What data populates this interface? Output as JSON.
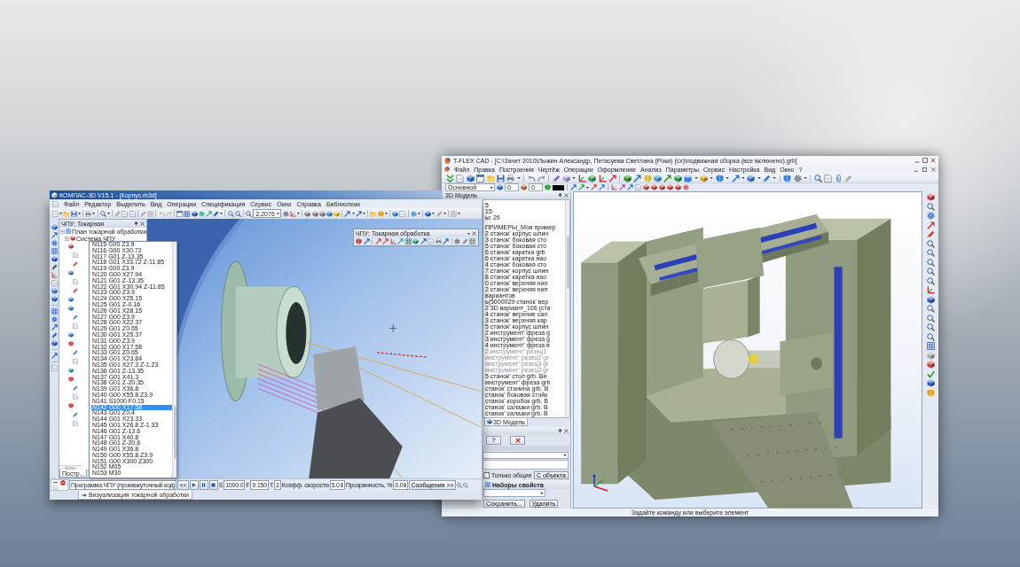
{
  "kompas_window": {
    "title": "КОМПАС-3D V15.1 - [Корпус.m3d]",
    "menu": [
      "Файл",
      "Редактор",
      "Выделить",
      "Вид",
      "Операции",
      "Спецификация",
      "Сервис",
      "Окно",
      "Справка",
      "Библиотеки"
    ],
    "zoom_field": {
      "value": "2.2076"
    },
    "tree_panel": {
      "title": "ЧПУ: Токарная",
      "tree": [
        {
          "label": "План токарной обработки",
          "expanded": true,
          "children": [
            {
              "label": "Система ЧПУ",
              "expanded": true
            }
          ]
        }
      ],
      "tab": "Постр..."
    },
    "nc_toolbar": {
      "title": "ЧПУ: Токарная обработка"
    },
    "program_list": {
      "lines": [
        {
          "text": "N115 G00 Z3.9",
          "selected": false
        },
        {
          "text": "N116 G00 X30.72",
          "selected": false
        },
        {
          "text": "N117 G01 Z-13.35",
          "selected": false
        },
        {
          "text": "N118 G01 X33.72 Z-11.85",
          "selected": false
        },
        {
          "text": "N119 G00 Z3.9",
          "selected": false
        },
        {
          "text": "N120 G00 X27.94",
          "selected": false
        },
        {
          "text": "N121 G01 Z-13.35",
          "selected": false
        },
        {
          "text": "N122 G01 X30.94 Z-11.85",
          "selected": false
        },
        {
          "text": "N123 G00 Z3.9",
          "selected": false
        },
        {
          "text": "N124 G00 X25.15",
          "selected": false
        },
        {
          "text": "N125 G01 Z-0.16",
          "selected": false
        },
        {
          "text": "N126 G01 X28.15",
          "selected": false
        },
        {
          "text": "N127 G00 Z3.9",
          "selected": false
        },
        {
          "text": "N128 G00 X22.37",
          "selected": false
        },
        {
          "text": "N129 G01 Z0.65",
          "selected": false
        },
        {
          "text": "N130 G01 X25.37",
          "selected": false
        },
        {
          "text": "N131 G00 Z3.9",
          "selected": false
        },
        {
          "text": "N132 G00 X17.58",
          "selected": false
        },
        {
          "text": "N133 G01 Z0.65",
          "selected": false
        },
        {
          "text": "N134 G01 X23.84",
          "selected": false
        },
        {
          "text": "N135 G01 X27.3 Z-1.23",
          "selected": false
        },
        {
          "text": "N136 G01 Z-13.35",
          "selected": false
        },
        {
          "text": "N137 G01 X41.3",
          "selected": false
        },
        {
          "text": "N138 G01 Z-20.35",
          "selected": false
        },
        {
          "text": "N139 G01 X36.8",
          "selected": false
        },
        {
          "text": "N140 G00 X55.8 Z3.9",
          "selected": false
        },
        {
          "text": "N141 S1000 F0.15",
          "selected": false
        },
        {
          "text": "N142 G00 X17.58",
          "selected": true
        },
        {
          "text": "N143 G01 Z0.4",
          "selected": false
        },
        {
          "text": "N144 G01 X23.33",
          "selected": false
        },
        {
          "text": "N145 G01 X26.8 Z-1.33",
          "selected": false
        },
        {
          "text": "N146 G01 Z-13.6",
          "selected": false
        },
        {
          "text": "N147 G01 X40.8",
          "selected": false
        },
        {
          "text": "N148 G01 Z-20.6",
          "selected": false
        },
        {
          "text": "N149 G01 X36.8",
          "selected": false
        },
        {
          "text": "N150 G00 X55.8 Z3.9",
          "selected": false
        },
        {
          "text": "N151 G00 X300 Z300",
          "selected": false
        },
        {
          "text": "N152 M05",
          "selected": false
        },
        {
          "text": "N153 M30",
          "selected": false
        }
      ]
    },
    "player_bar": {
      "program_field": {
        "value": "Программа ЧПУ (промежуточный код)"
      },
      "back_button": "<<",
      "s_label": "S",
      "s_field": {
        "value": "1000.0"
      },
      "f_label": "F",
      "f_field": {
        "value": "0.150"
      },
      "t_label": "T",
      "t_field": {
        "value": "2"
      },
      "speed_label": "Коэфф. скорости",
      "speed_field": {
        "value": "5.0"
      },
      "transparency_label": "Прозрачность, %",
      "transparency_field": {
        "value": "0.0"
      },
      "messages_button": {
        "label": "Сообщения",
        "arrows": ">>"
      }
    },
    "document_tab": {
      "label": "Визуализация токарной обработки",
      "selected": true
    }
  },
  "tflex_window": {
    "title": "T-FLEX CAD - [C:\\Зачет 2010\\Лыжин Александр, Петасуева Светлана (Роки) (сх)\\подвижная сборка (все включено).grb]",
    "menu": [
      "Файл",
      "Правка",
      "Построения",
      "Чертёж",
      "Операции",
      "Оформление",
      "Анализ",
      "Параметры",
      "Сервис",
      "Настройка",
      "Вид",
      "Окно",
      "?"
    ],
    "style_field": {
      "value": "Основной"
    },
    "layer_field": {
      "value": "0"
    },
    "level_field": {
      "value": "0"
    },
    "model_panel": {
      "title": "3D Модель",
      "summary_lines": [
        "5",
        "15",
        "ы: 29"
      ],
      "items": [
        {
          "text": "ПРИМЕРЫ_Моя пример",
          "disabled": false
        },
        {
          "text": "2 станок' корпус шпин",
          "disabled": false
        },
        {
          "text": "3 станок' боковая сто",
          "disabled": false
        },
        {
          "text": "5 станок' боковая сто",
          "disabled": false
        },
        {
          "text": "6 станок' каретка grb",
          "disabled": false
        },
        {
          "text": "6 станок' каретка нао",
          "disabled": false
        },
        {
          "text": "4 станок' боковая сто",
          "disabled": false
        },
        {
          "text": "7 станок' корпус шпин",
          "disabled": false
        },
        {
          "text": "8 станок' каретка нао",
          "disabled": false
        },
        {
          "text": "0 станок' верхняя нап",
          "disabled": false
        },
        {
          "text": "2 станок' верхняя нап",
          "disabled": false
        },
        {
          "text": "вариантов",
          "disabled": false
        },
        {
          "text": "ь(5000029 станок' вер",
          "disabled": false
        },
        {
          "text": "2 3D вариант_106 (ста",
          "disabled": false
        },
        {
          "text": "4 станок' верхние сал",
          "disabled": false
        },
        {
          "text": "3 станок' верхняя кар",
          "disabled": false
        },
        {
          "text": "5 станок' корпус шпин",
          "disabled": false
        },
        {
          "text": "2 инструмент' фреза g",
          "disabled": false
        },
        {
          "text": "3 инструмент' фреза g",
          "disabled": false
        },
        {
          "text": "4 инструмент' фреза в",
          "disabled": false
        },
        {
          "text": "2 инструмент' резец1",
          "disabled": true
        },
        {
          "text": "инструмент' резец2 gr",
          "disabled": true
        },
        {
          "text": "инструмент' резец3 gr",
          "disabled": true
        },
        {
          "text": "инструмент' резец2 gr",
          "disabled": true
        },
        {
          "text": "5 станок' стол grb. Вн",
          "disabled": false
        },
        {
          "text": "инструмент' фреза grb",
          "disabled": false
        },
        {
          "text": "станок' станина grb. В",
          "disabled": false
        },
        {
          "text": "станок' боковая стойк",
          "disabled": false
        },
        {
          "text": "станок' коробок grb. В",
          "disabled": false
        },
        {
          "text": "станок' салазки grb. В",
          "disabled": false
        },
        {
          "text": "станок' салазки grb. В",
          "disabled": false
        }
      ],
      "tab": {
        "label": "3D Модель",
        "selected": true
      }
    },
    "properties_panel": {
      "help_button": "?",
      "only_common": {
        "label": "Только общие",
        "checked": false
      },
      "from_object_button": "С объекта",
      "sets_title": "Наборы свойств",
      "save_button": "Сохранить...",
      "delete_button": "Удалить"
    },
    "status_bar": "Задайте команду или выберите элемент"
  }
}
